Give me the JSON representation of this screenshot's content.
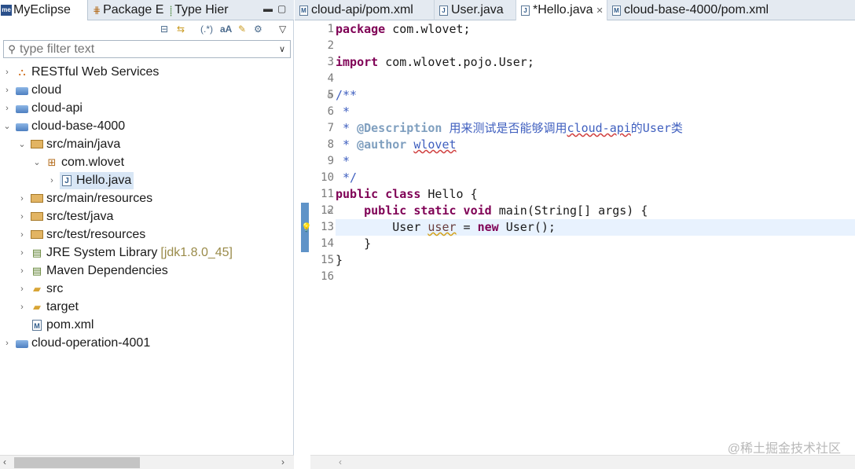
{
  "left_tabs": [
    {
      "label": "MyEclipse",
      "icon": "myeclipse-logo",
      "active": true
    },
    {
      "label": "Package E",
      "icon": "package-explorer-icon",
      "active": false
    },
    {
      "label": "Type Hier",
      "icon": "type-hierarchy-icon",
      "active": false
    }
  ],
  "filter": {
    "placeholder": "type filter text"
  },
  "tree": [
    {
      "label": "RESTful Web Services",
      "level": 0,
      "twisty": "collapsed",
      "icon": "rest-icon"
    },
    {
      "label": "cloud",
      "level": 0,
      "twisty": "collapsed",
      "icon": "project-icon"
    },
    {
      "label": "cloud-api",
      "level": 0,
      "twisty": "collapsed",
      "icon": "project-icon"
    },
    {
      "label": "cloud-base-4000",
      "level": 0,
      "twisty": "expanded",
      "icon": "project-icon"
    },
    {
      "label": "src/main/java",
      "level": 1,
      "twisty": "expanded",
      "icon": "source-folder-icon"
    },
    {
      "label": "com.wlovet",
      "level": 2,
      "twisty": "expanded",
      "icon": "package-icon"
    },
    {
      "label": "Hello.java",
      "level": 3,
      "twisty": "collapsed",
      "icon": "java-file-icon",
      "selected": true
    },
    {
      "label": "src/main/resources",
      "level": 1,
      "twisty": "collapsed",
      "icon": "source-folder-icon"
    },
    {
      "label": "src/test/java",
      "level": 1,
      "twisty": "collapsed",
      "icon": "source-folder-icon"
    },
    {
      "label": "src/test/resources",
      "level": 1,
      "twisty": "collapsed",
      "icon": "source-folder-icon"
    },
    {
      "label": "JRE System Library",
      "suffix": "[jdk1.8.0_45]",
      "level": 1,
      "twisty": "collapsed",
      "icon": "library-icon"
    },
    {
      "label": "Maven Dependencies",
      "level": 1,
      "twisty": "collapsed",
      "icon": "library-icon"
    },
    {
      "label": "src",
      "level": 1,
      "twisty": "collapsed",
      "icon": "folder-icon"
    },
    {
      "label": "target",
      "level": 1,
      "twisty": "collapsed",
      "icon": "folder-icon"
    },
    {
      "label": "pom.xml",
      "level": 1,
      "twisty": "none",
      "icon": "xml-file-icon"
    },
    {
      "label": "cloud-operation-4001",
      "level": 0,
      "twisty": "collapsed",
      "icon": "project-icon"
    }
  ],
  "editor_tabs": [
    {
      "label": "cloud-api/pom.xml",
      "icon": "M",
      "active": false
    },
    {
      "label": "User.java",
      "icon": "J",
      "active": false
    },
    {
      "label": "*Hello.java",
      "icon": "J",
      "active": true
    },
    {
      "label": "cloud-base-4000/pom.xml",
      "icon": "M",
      "active": false
    }
  ],
  "code": {
    "line_numbers": [
      "1",
      "2",
      "3",
      "4",
      "5",
      "6",
      "7",
      "8",
      "9",
      "10",
      "11",
      "12",
      "13",
      "14",
      "15",
      "16"
    ],
    "line1_kw": "package",
    "line1_rest": " com.wlovet;",
    "line3_kw": "import",
    "line3_rest": " com.wlovet.pojo.User;",
    "line5": "/**",
    "line6": " *",
    "line7_pre": " * ",
    "line7_tag": "@Description",
    "line7_text": " 用来测试是否能够调用",
    "line7_sq": "cloud-api",
    "line7_post": "的User类",
    "line8_pre": " * ",
    "line8_tag": "@author",
    "line8_sp": " ",
    "line8_sq": "wlovet",
    "line9": " *",
    "line10": " */",
    "line11_kw": "public class",
    "line11_rest": " Hello {",
    "line12_indent": "    ",
    "line12_kw": "public static void",
    "line12_rest": " main(String[] args) {",
    "line13_pre": "        User ",
    "line13_var": "user",
    "line13_mid": " = ",
    "line13_kw": "new",
    "line13_post": " User();",
    "line14": "    }",
    "line15": "}"
  },
  "watermark": "@稀土掘金技术社区"
}
